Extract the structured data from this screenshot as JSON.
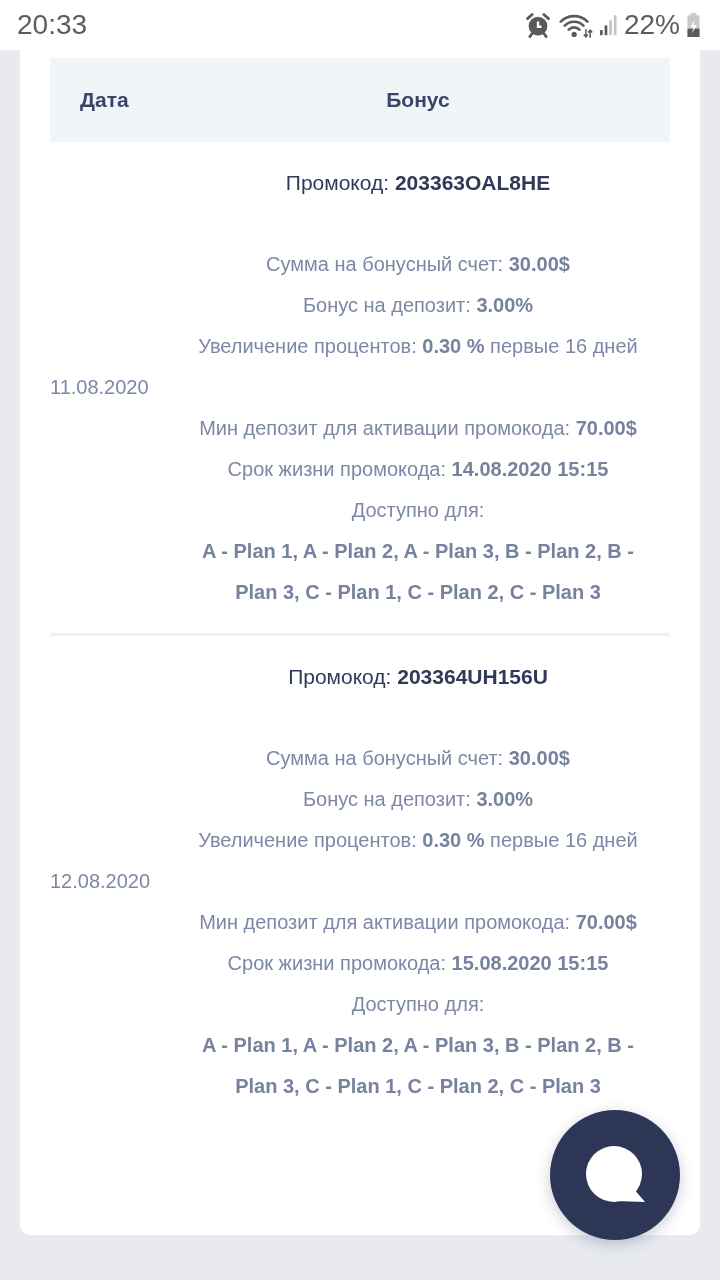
{
  "status_bar": {
    "time": "20:33",
    "battery": "22%"
  },
  "table": {
    "columns": [
      "Дата",
      "Бонус"
    ],
    "rows": [
      {
        "date": "11.08.2020",
        "promo": "Промокод: **203363OAL8HE**",
        "bonus_lines": [
          "Сумма на бонусный счет: **30.00$**",
          "Бонус на депозит: **3.00%**",
          "Увеличение процентов: **0.30 %** первые 16 дней"
        ],
        "conditions": [
          "Мин депозит для активации промокода: **70.00$**",
          "Срок жизни промокода: **14.08.2020 15:15**",
          "Доступно для:"
        ],
        "plans": "A - Plan 1, A - Plan 2, A - Plan 3, B - Plan 2, B - Plan 3, C - Plan 1, C - Plan 2, C - Plan 3"
      },
      {
        "date": "12.08.2020",
        "promo": "Промокод: **203364UH156U**",
        "bonus_lines": [
          "Сумма на бонусный счет: **30.00$**",
          "Бонус на депозит: **3.00%**",
          "Увеличение процентов: **0.30 %** первые 16 дней"
        ],
        "conditions": [
          "Мин депозит для активации промокода: **70.00$**",
          "Срок жизни промокода: **15.08.2020 15:15**",
          "Доступно для:"
        ],
        "plans": "A - Plan 1, A - Plan 2, A - Plan 3, B - Plan 2, B - Plan 3, C - Plan 1, C - Plan 2, C - Plan 3"
      }
    ]
  }
}
